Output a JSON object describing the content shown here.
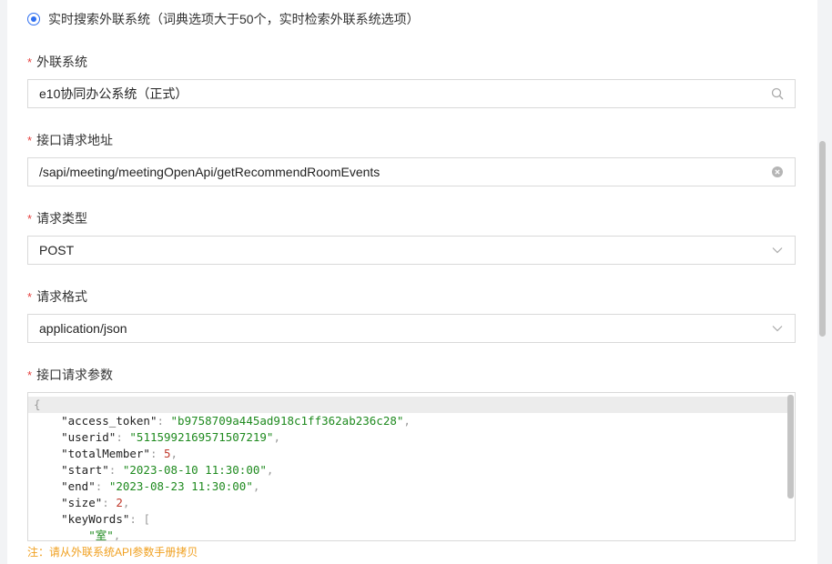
{
  "radio_option": {
    "label": "实时搜索外联系统（词典选项大于50个，实时检索外联系统选项）",
    "selected": true
  },
  "required_mark": "*",
  "fields": {
    "external_system": {
      "label": "外联系统",
      "value": "e10协同办公系统（正式）",
      "icon": "search-icon"
    },
    "api_address": {
      "label": "接口请求地址",
      "value": "/sapi/meeting/meetingOpenApi/getRecommendRoomEvents",
      "icon": "clear-icon"
    },
    "request_type": {
      "label": "请求类型",
      "value": "POST",
      "icon": "chevron-down-icon"
    },
    "request_format": {
      "label": "请求格式",
      "value": "application/json",
      "icon": "chevron-down-icon"
    },
    "request_params": {
      "label": "接口请求参数"
    }
  },
  "code": {
    "open_brace": "{",
    "entries": [
      {
        "key": "\"access_token\"",
        "sep": ": ",
        "value": "\"b9758709a445ad918c1ff362ab236c28\"",
        "type": "string",
        "tail": ","
      },
      {
        "key": "\"userid\"",
        "sep": ": ",
        "value": "\"5115992169571507219\"",
        "type": "string",
        "tail": ","
      },
      {
        "key": "\"totalMember\"",
        "sep": ": ",
        "value": "5",
        "type": "number",
        "tail": ","
      },
      {
        "key": "\"start\"",
        "sep": ": ",
        "value": "\"2023-08-10 11:30:00\"",
        "type": "string",
        "tail": ","
      },
      {
        "key": "\"end\"",
        "sep": ": ",
        "value": "\"2023-08-23 11:30:00\"",
        "type": "string",
        "tail": ","
      },
      {
        "key": "\"size\"",
        "sep": ": ",
        "value": "2",
        "type": "number",
        "tail": ","
      },
      {
        "key": "\"keyWords\"",
        "sep": ": ",
        "value": "[",
        "type": "punct",
        "tail": ""
      }
    ],
    "array_item": {
      "value": "\"室\"",
      "tail": ","
    }
  },
  "hint": "注：请从外联系统API参数手册拷贝",
  "colors": {
    "accent": "#2f6ff0",
    "required": "#e5413f",
    "hint": "#f0a020",
    "string": "#1e8a1e",
    "number": "#c0392b"
  }
}
